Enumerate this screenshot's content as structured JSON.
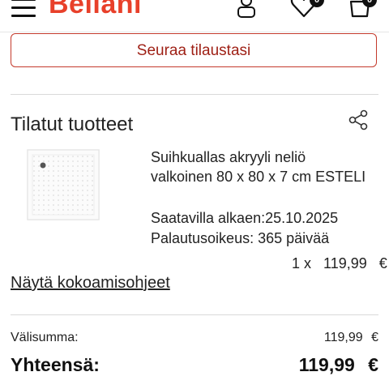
{
  "header": {
    "logo": "Beliani",
    "favorites_count": "0",
    "cart_count": "0"
  },
  "follow_order_label": "Seuraa tilaustasi",
  "ordered": {
    "title": "Tilatut tuotteet",
    "product": {
      "name_line1": "Suihkuallas akryyli neliö",
      "name_line2": "valkoinen 80 x 80 x 7 cm ESTELI",
      "availability": "Saatavilla alkaen:25.10.2025",
      "return_right": "Palautusoikeus: 365 päivää",
      "quantity": "1 x",
      "price": "119,99",
      "currency": "€"
    },
    "assembly_link": "Näytä kokoamisohjeet"
  },
  "summary": {
    "subtotal_label": "Välisumma:",
    "subtotal_value": "119,99",
    "subtotal_currency": "€",
    "total_label": "Yhteensä:",
    "total_value": "119,99",
    "total_currency": "€"
  },
  "colors": {
    "brand": "#e8402a",
    "button_border": "#c43a2c",
    "button_text": "#9e1f14"
  }
}
